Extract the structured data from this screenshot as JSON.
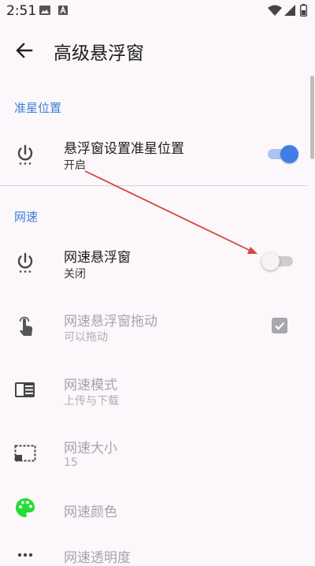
{
  "status_bar": {
    "time": "2:51"
  },
  "app_bar": {
    "title": "高级悬浮窗"
  },
  "sections": {
    "crosshair": {
      "title": "准星位置"
    },
    "netspeed": {
      "title": "网速"
    }
  },
  "rows": {
    "crosshair_float": {
      "title": "悬浮窗设置准星位置",
      "summary": "开启",
      "enabled": true
    },
    "netspeed_float": {
      "title": "网速悬浮窗",
      "summary": "关闭",
      "enabled": false
    },
    "netspeed_drag": {
      "title": "网速悬浮窗拖动",
      "summary": "可以拖动",
      "checked": true
    },
    "netspeed_mode": {
      "title": "网速模式",
      "summary": "上传与下载"
    },
    "netspeed_size": {
      "title": "网速大小",
      "summary": "15"
    },
    "netspeed_color": {
      "title": "网速颜色"
    },
    "netspeed_opacity": {
      "title": "网速透明度"
    }
  },
  "colors": {
    "accent": "#3f7fe5",
    "section_header": "#3f7fd8",
    "annotation_arrow": "#d6453b",
    "palette_icon": "#22dd33"
  }
}
